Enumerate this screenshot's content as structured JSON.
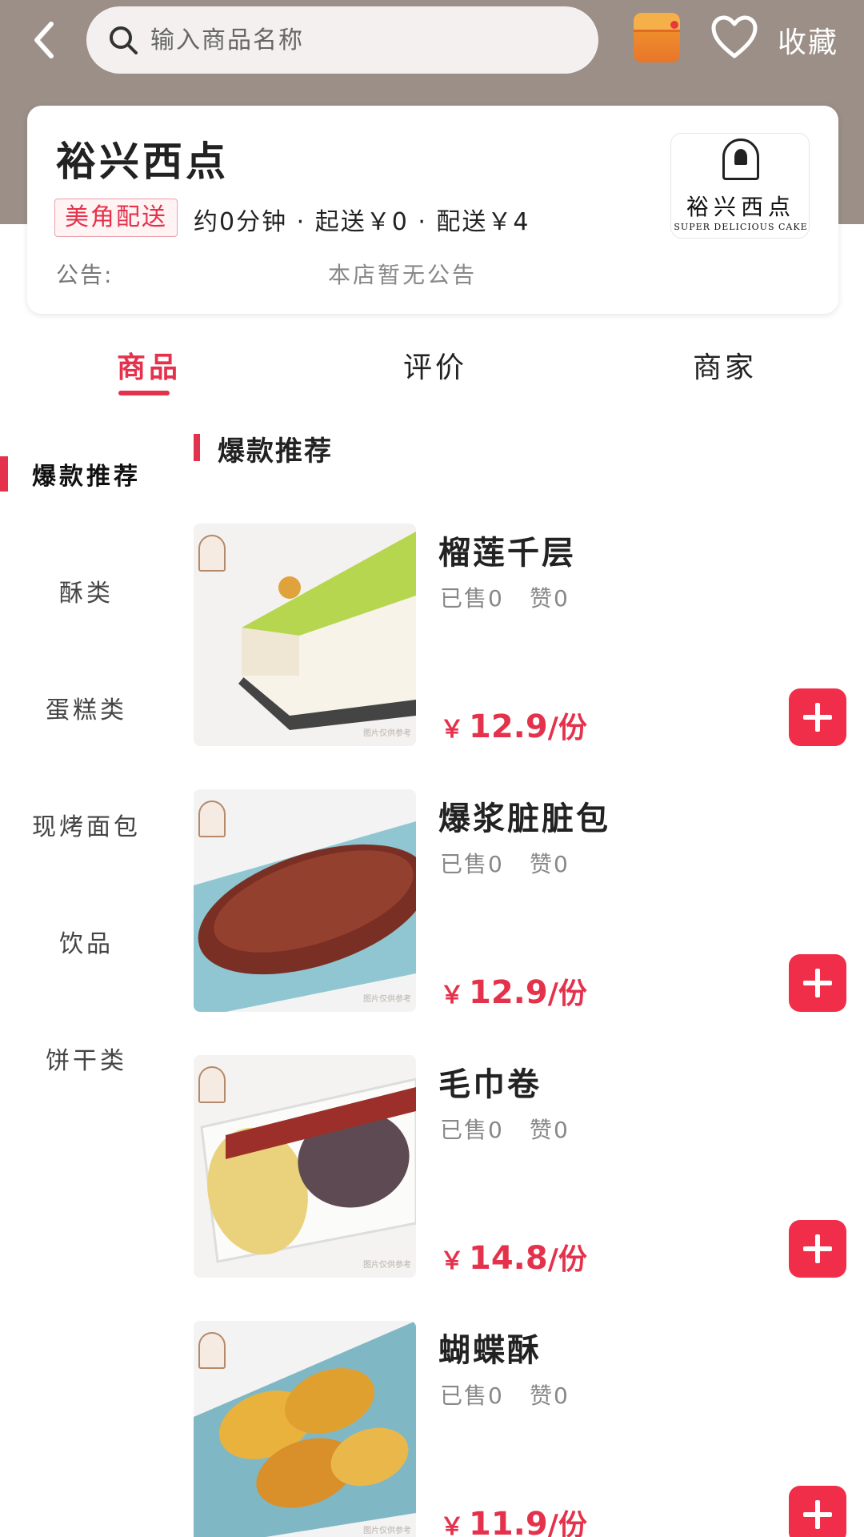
{
  "header": {
    "search_placeholder": "输入商品名称",
    "favorite_label": "收藏",
    "icons": [
      "back-icon",
      "search-icon",
      "red-packet-icon",
      "heart-icon"
    ]
  },
  "shop": {
    "name": "裕兴西点",
    "delivery_tag": "美角配送",
    "delivery_info": "约0分钟 · 起送￥0 · 配送￥4",
    "notice_label": "公告:",
    "notice_text": "本店暂无公告",
    "logo": {
      "cn": "裕兴西点",
      "en": "SUPER DELICIOUS CAKE"
    }
  },
  "tabs": [
    {
      "label": "商品",
      "active": true
    },
    {
      "label": "评价",
      "active": false
    },
    {
      "label": "商家",
      "active": false
    }
  ],
  "sidebar": {
    "items": [
      {
        "label": "爆款推荐",
        "active": true
      },
      {
        "label": "酥类",
        "active": false
      },
      {
        "label": "蛋糕类",
        "active": false
      },
      {
        "label": "现烤面包",
        "active": false
      },
      {
        "label": "饮品",
        "active": false
      },
      {
        "label": "饼干类",
        "active": false
      }
    ]
  },
  "section": {
    "title": "爆款推荐"
  },
  "products": [
    {
      "name": "榴莲千层",
      "sold": "已售0",
      "likes": "赞0",
      "yen": "￥",
      "amount": "12.9",
      "unit": "/份",
      "image": "durian-crepe-cake"
    },
    {
      "name": "爆浆脏脏包",
      "sold": "已售0",
      "likes": "赞0",
      "yen": "￥",
      "amount": "12.9",
      "unit": "/份",
      "image": "chocolate-dirty-bun"
    },
    {
      "name": "毛巾卷",
      "sold": "已售0",
      "likes": "赞0",
      "yen": "￥",
      "amount": "14.8",
      "unit": "/份",
      "image": "towel-roll-cake"
    },
    {
      "name": "蝴蝶酥",
      "sold": "已售0",
      "likes": "赞0",
      "yen": "￥",
      "amount": "11.9",
      "unit": "/份",
      "image": "butterfly-pastry"
    }
  ],
  "colors": {
    "accent": "#e4324c",
    "add_button": "#f12e4a",
    "header_band": "#9b8f87"
  }
}
